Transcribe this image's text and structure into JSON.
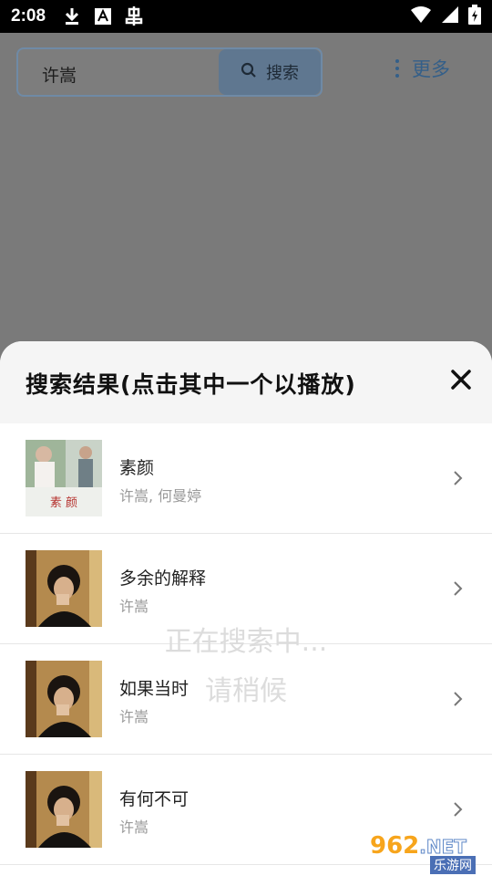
{
  "statusbar": {
    "time": "2:08"
  },
  "search": {
    "value": "许嵩",
    "button_label": "搜索"
  },
  "toolbar": {
    "more_label": "更多"
  },
  "sheet": {
    "title": "搜索结果(点击其中一个以播放)",
    "results": [
      {
        "title": "素颜",
        "artist": "许嵩, 何曼婷",
        "thumb": "album-cover-suyan"
      },
      {
        "title": "多余的解释",
        "artist": "许嵩",
        "thumb": "album-cover-portrait"
      },
      {
        "title": "如果当时",
        "artist": "许嵩",
        "thumb": "album-cover-portrait"
      },
      {
        "title": "有何不可",
        "artist": "许嵩",
        "thumb": "album-cover-portrait"
      }
    ]
  },
  "overlay": {
    "line1": "正在搜索中...",
    "line2": "请稍候"
  },
  "watermark": {
    "brand": "962",
    "suffix": ".NET",
    "sub": "乐游网"
  }
}
